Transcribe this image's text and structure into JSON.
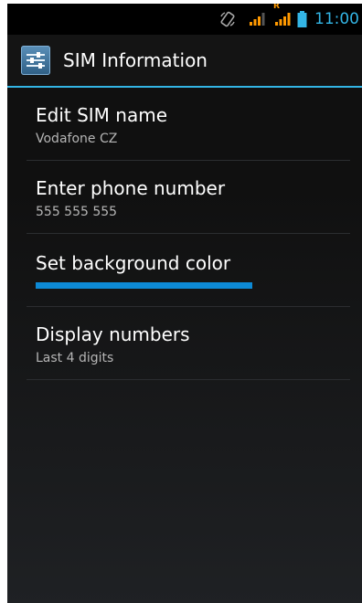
{
  "status_bar": {
    "time": "11:00",
    "roaming_badge": "R",
    "icons": [
      "screen-rotation-icon",
      "cell-signal-icon",
      "cell-signal-roaming-icon",
      "battery-icon"
    ],
    "colors": {
      "time": "#33b5e5",
      "signal": "#ff9900",
      "battery": "#33b5e5"
    }
  },
  "action_bar": {
    "title": "SIM Information",
    "icon": "settings-sliders-icon",
    "accent_color": "#33b5e5"
  },
  "preferences": [
    {
      "title": "Edit SIM name",
      "summary": "Vodafone CZ"
    },
    {
      "title": "Enter phone number",
      "summary": "555 555 555"
    },
    {
      "title": "Set background color",
      "color": "#0d8ad6"
    },
    {
      "title": "Display numbers",
      "summary": "Last 4 digits"
    }
  ]
}
